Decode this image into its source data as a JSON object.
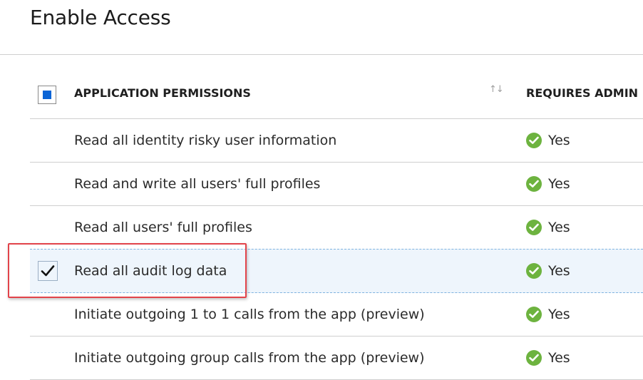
{
  "title": "Enable Access",
  "table": {
    "columns": {
      "permissions": "APPLICATION PERMISSIONS",
      "requires_admin": "REQUIRES ADMIN"
    },
    "select_all_state": "indeterminate",
    "sort_icon": "sort-icon",
    "rows": [
      {
        "label": "Read all identity risky user information",
        "requires_admin": "Yes",
        "selected": false
      },
      {
        "label": "Read and write all users' full profiles",
        "requires_admin": "Yes",
        "selected": false
      },
      {
        "label": "Read all users' full profiles",
        "requires_admin": "Yes",
        "selected": false
      },
      {
        "label": "Read all audit log data",
        "requires_admin": "Yes",
        "selected": true
      },
      {
        "label": "Initiate outgoing 1 to 1 calls from the app (preview)",
        "requires_admin": "Yes",
        "selected": false
      },
      {
        "label": "Initiate outgoing group calls from the app (preview)",
        "requires_admin": "Yes",
        "selected": false
      }
    ]
  },
  "colors": {
    "accent": "#0a64d6",
    "success": "#6db33f",
    "selection_bg": "#eef5fc",
    "annotation": "#e2434a"
  }
}
